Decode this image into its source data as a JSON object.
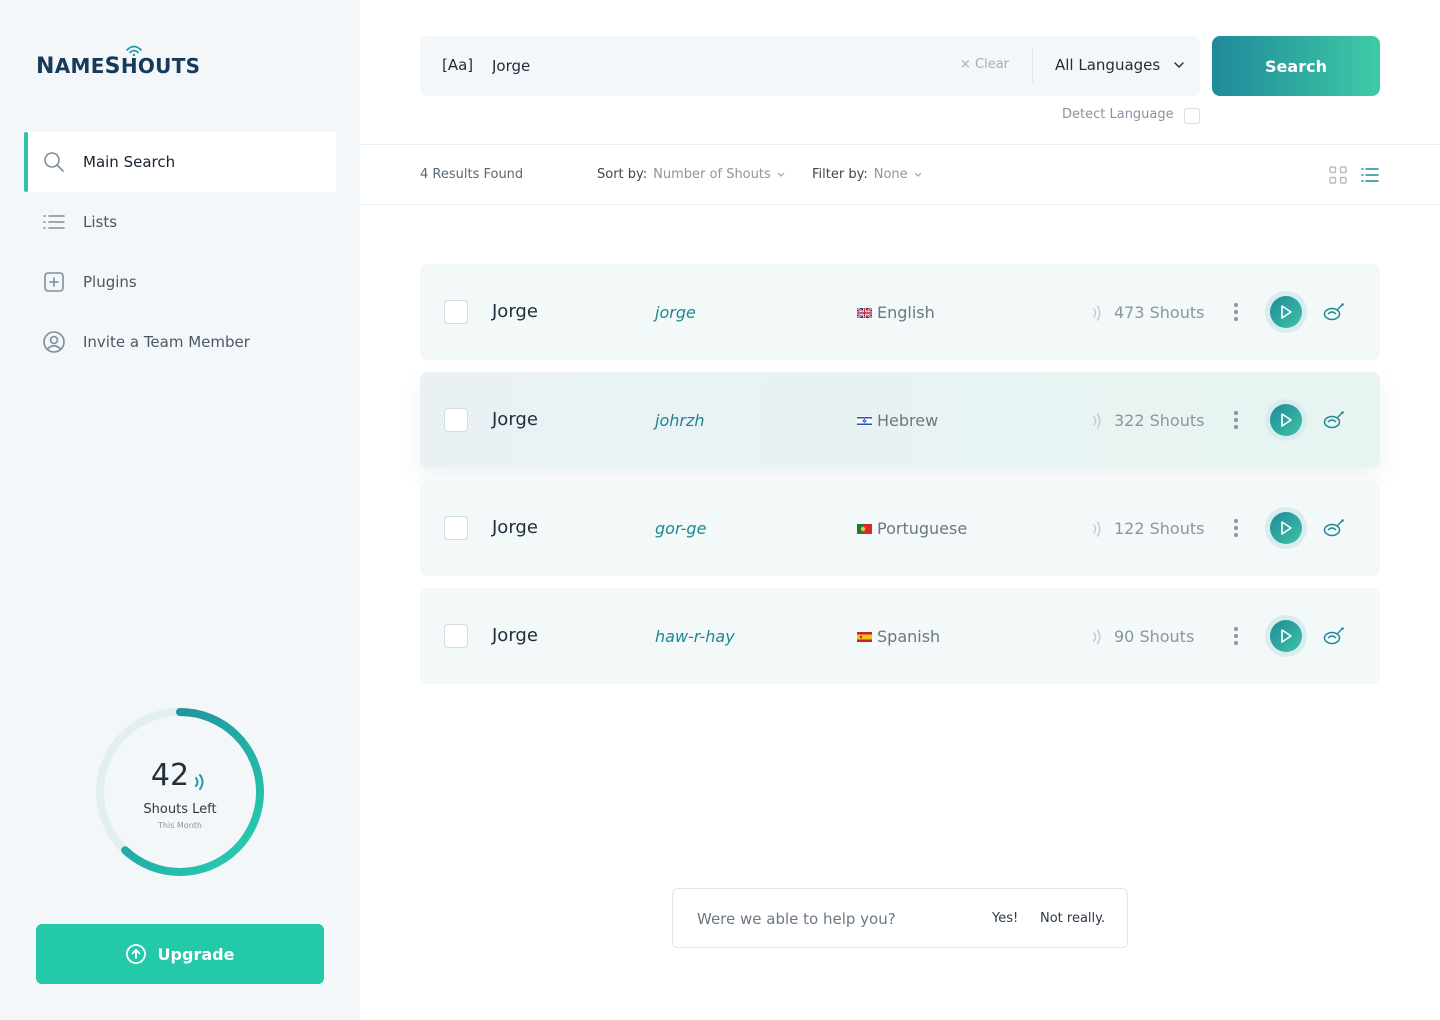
{
  "app": {
    "logo_text_1": "N",
    "logo_text_2": "AME",
    "logo_text_3": "S",
    "logo_text_4": "HOUTS"
  },
  "sidebar": {
    "items": [
      {
        "label": "Main Search",
        "icon": "search-icon",
        "active": true
      },
      {
        "label": "Lists",
        "icon": "list-icon",
        "active": false
      },
      {
        "label": "Plugins",
        "icon": "plus-square-icon",
        "active": false
      },
      {
        "label": "Invite a Team Member",
        "icon": "user-circle-icon",
        "active": false
      }
    ],
    "meter": {
      "value": "42",
      "fraction_used": 0.58,
      "label": "Shouts Left",
      "sub": "This Month"
    },
    "upgrade_label": "Upgrade"
  },
  "search": {
    "case_toggle": "[Aa]",
    "query": "Jorge",
    "clear_label": "Clear",
    "language": "All Languages",
    "button_label": "Search",
    "detect_label": "Detect Language"
  },
  "toolbar": {
    "results": "4 Results Found",
    "sort_label": "Sort by:",
    "sort_value": "Number of Shouts",
    "filter_label": "Filter by:",
    "filter_value": "None"
  },
  "results": [
    {
      "name": "Jorge",
      "phonetic": "jorge",
      "language": "English",
      "flag": "gb-flag-icon",
      "shouts": "473 Shouts"
    },
    {
      "name": "Jorge",
      "phonetic": "johrzh",
      "language": "Hebrew",
      "flag": "il-flag-icon",
      "shouts": "322 Shouts"
    },
    {
      "name": "Jorge",
      "phonetic": "gor-ge",
      "language": "Portuguese",
      "flag": "pt-flag-icon",
      "shouts": "122 Shouts"
    },
    {
      "name": "Jorge",
      "phonetic": "haw-r-hay",
      "language": "Spanish",
      "flag": "es-flag-icon",
      "shouts": "90 Shouts"
    }
  ],
  "feedback": {
    "question": "Were we able to help you?",
    "yes": "Yes!",
    "no": "Not really."
  },
  "colors": {
    "accent": "#23c9a8",
    "brand_dark": "#183a5a",
    "teal": "#1f8a9a"
  }
}
